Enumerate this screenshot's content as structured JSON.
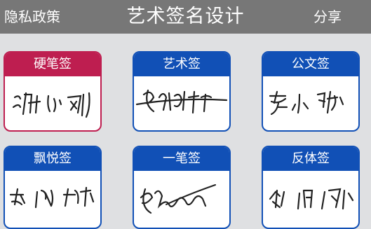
{
  "topbar": {
    "left_label": "隐私政策",
    "title": "艺术签名设计",
    "right_label": "分享"
  },
  "cards": [
    {
      "label": "硬笔签",
      "accent": "#be1e50"
    },
    {
      "label": "艺术签",
      "accent": "#1150b6"
    },
    {
      "label": "公文签",
      "accent": "#1150b6"
    },
    {
      "label": "飘悦签",
      "accent": "#1150b6"
    },
    {
      "label": "一笔签",
      "accent": "#1150b6"
    },
    {
      "label": "反体签",
      "accent": "#1150b6"
    }
  ]
}
